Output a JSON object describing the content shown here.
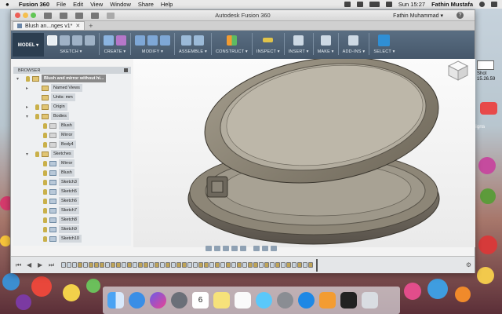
{
  "menubar": {
    "app": "Fusion 360",
    "items": [
      "File",
      "Edit",
      "View",
      "Window",
      "Share",
      "Help"
    ],
    "clock": "Sun 15:27",
    "user": "Fathin Mustafa"
  },
  "window": {
    "title": "Autodesk Fusion 360",
    "user": "Fathin Muhammad ▾",
    "help": "?"
  },
  "doctab": {
    "label": "Blush an...nges v1*",
    "close": "✕",
    "new": "+"
  },
  "ribbon": {
    "workspace": "MODEL ▾",
    "groups": [
      "SKETCH ▾",
      "CREATE ▾",
      "MODIFY ▾",
      "ASSEMBLE ▾",
      "CONSTRUCT ▾",
      "INSPECT ▾",
      "INSERT ▾",
      "MAKE ▾",
      "ADD-INS ▾",
      "SELECT ▾"
    ]
  },
  "browser": {
    "title": "BROWSER",
    "rows": [
      {
        "label": "Blush and mirror without hi...",
        "level": 0,
        "selected": true,
        "kind": "root"
      },
      {
        "label": "Named Views",
        "level": 1,
        "kind": "folder"
      },
      {
        "label": "Units: mm",
        "level": 1,
        "kind": "doc"
      },
      {
        "label": "Origin",
        "level": 1,
        "kind": "folder"
      },
      {
        "label": "Bodies",
        "level": 1,
        "kind": "folder"
      },
      {
        "label": "Blush",
        "level": 2,
        "kind": "body"
      },
      {
        "label": "Mirror",
        "level": 2,
        "kind": "body"
      },
      {
        "label": "Body4",
        "level": 2,
        "kind": "body"
      },
      {
        "label": "Sketches",
        "level": 1,
        "kind": "folder"
      },
      {
        "label": "Mirror",
        "level": 2,
        "kind": "sketch"
      },
      {
        "label": "Blush",
        "level": 2,
        "kind": "sketch"
      },
      {
        "label": "Sketch3",
        "level": 2,
        "kind": "sketch"
      },
      {
        "label": "Sketch5",
        "level": 2,
        "kind": "sketch"
      },
      {
        "label": "Sketch6",
        "level": 2,
        "kind": "sketch"
      },
      {
        "label": "Sketch7",
        "level": 2,
        "kind": "sketch"
      },
      {
        "label": "Sketch8",
        "level": 2,
        "kind": "sketch"
      },
      {
        "label": "Sketch9",
        "level": 2,
        "kind": "sketch"
      },
      {
        "label": "Sketch10",
        "level": 2,
        "kind": "sketch"
      }
    ]
  },
  "timeline": {
    "play": [
      "⏮",
      "◀",
      "▶",
      "⏭"
    ]
  },
  "dock": {
    "calendar_day": "6"
  },
  "desktop": {
    "shot": "Shot",
    "time": "15.26.59",
    "side": "signs"
  },
  "colors": {
    "ribbon": "#45576a",
    "accent": "#8a8a8a"
  }
}
